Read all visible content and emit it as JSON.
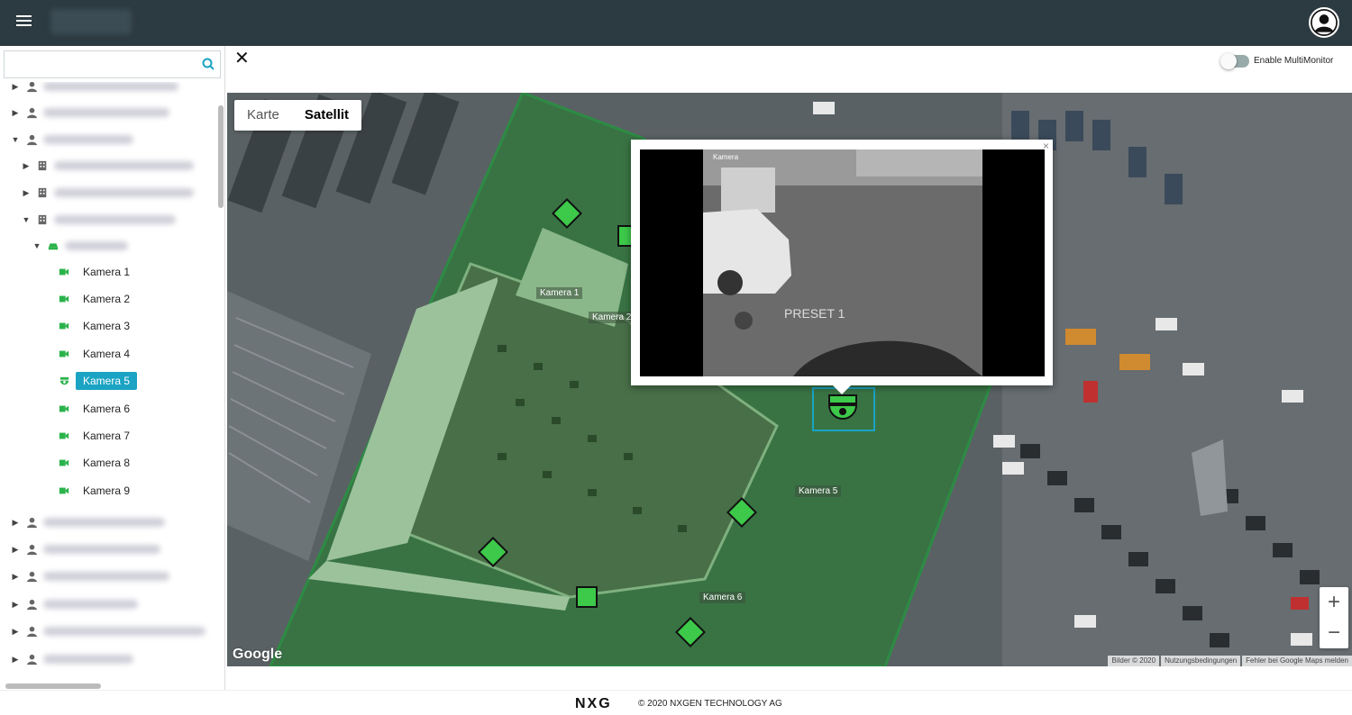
{
  "header": {
    "avatar_icon": "user-avatar-icon"
  },
  "sidebar": {
    "search": {
      "value": "",
      "placeholder": ""
    },
    "cameras": [
      {
        "label": "Kamera 1",
        "selected": false,
        "icon": "video-camera-icon"
      },
      {
        "label": "Kamera 2",
        "selected": false,
        "icon": "video-camera-icon"
      },
      {
        "label": "Kamera 3",
        "selected": false,
        "icon": "video-camera-icon"
      },
      {
        "label": "Kamera 4",
        "selected": false,
        "icon": "video-camera-icon"
      },
      {
        "label": "Kamera 5",
        "selected": true,
        "icon": "dome-camera-icon"
      },
      {
        "label": "Kamera 6",
        "selected": false,
        "icon": "video-camera-icon"
      },
      {
        "label": "Kamera 7",
        "selected": false,
        "icon": "video-camera-icon"
      },
      {
        "label": "Kamera 8",
        "selected": false,
        "icon": "video-camera-icon"
      },
      {
        "label": "Kamera 9",
        "selected": false,
        "icon": "video-camera-icon"
      }
    ]
  },
  "main": {
    "multimonitor_label": "Enable MultiMonitor",
    "multimonitor_enabled": false,
    "maptype": {
      "map": "Karte",
      "satellite": "Satellit",
      "active": "satellite"
    },
    "map_labels": [
      "Kamera 1",
      "Kamera 2",
      "Kamera 5",
      "Kamera 6"
    ],
    "zoom_in": "+",
    "zoom_out": "−",
    "google_logo": "Google",
    "attribution": [
      "Bilder © 2020",
      "Nutzungsbedingungen",
      "Fehler bei Google Maps melden"
    ],
    "popup": {
      "video_overlay_top": "Kamera",
      "video_overlay_preset": "PRESET  1",
      "close": "×"
    }
  },
  "footer": {
    "logo": "NXG",
    "copyright": "© 2020 NXGEN TECHNOLOGY AG"
  },
  "colors": {
    "topbar": "#2c3a41",
    "accent": "#1aa3c3",
    "camera_green": "#2bb34b"
  }
}
